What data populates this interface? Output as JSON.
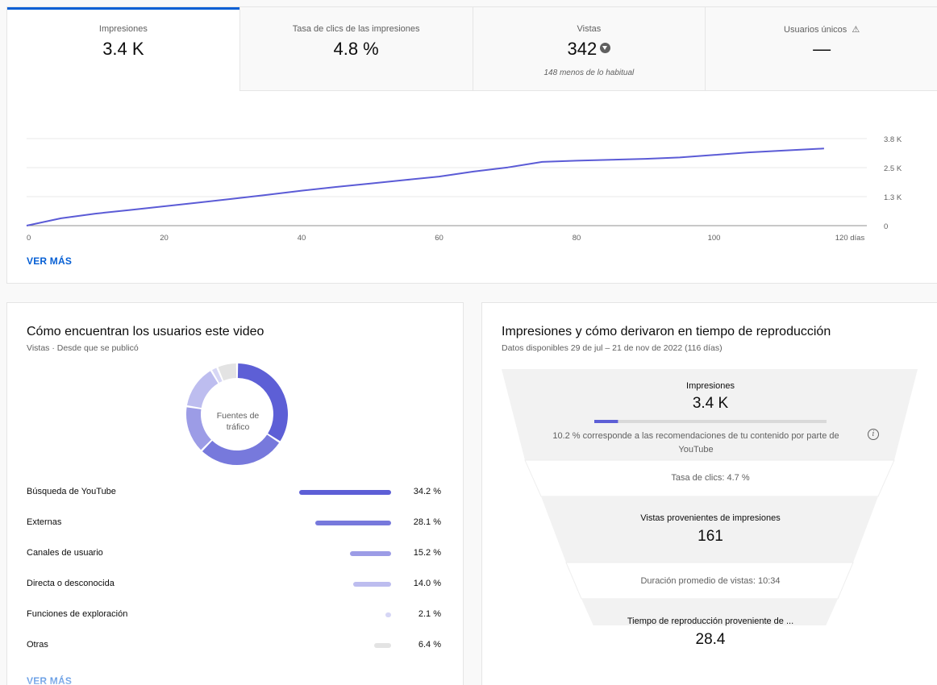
{
  "tabs": [
    {
      "label": "Impresiones",
      "value": "3.4 K",
      "sub": ""
    },
    {
      "label": "Tasa de clics de las impresiones",
      "value": "4.8 %",
      "sub": ""
    },
    {
      "label": "Vistas",
      "value": "342",
      "sub": "148 menos de lo habitual"
    },
    {
      "label": "Usuarios únicos",
      "value": "—",
      "sub": ""
    }
  ],
  "chart_data": {
    "type": "line",
    "x": [
      0,
      5,
      10,
      15,
      20,
      25,
      30,
      35,
      40,
      45,
      50,
      55,
      60,
      65,
      70,
      75,
      80,
      85,
      90,
      95,
      100,
      105,
      110,
      116
    ],
    "y": [
      0,
      320,
      520,
      680,
      840,
      1000,
      1170,
      1340,
      1520,
      1680,
      1830,
      1980,
      2130,
      2350,
      2530,
      2770,
      2820,
      2860,
      2900,
      2960,
      3070,
      3180,
      3260,
      3350
    ],
    "xticks": [
      "0",
      "20",
      "40",
      "60",
      "80",
      "100",
      "120 días"
    ],
    "xtick_values": [
      0,
      20,
      40,
      60,
      80,
      100,
      120
    ],
    "yticks": [
      "0",
      "1.3 K",
      "2.5 K",
      "3.8 K"
    ],
    "ytick_values": [
      0,
      1260,
      2520,
      3780
    ],
    "xlim": [
      0,
      120
    ],
    "ylim": [
      0,
      3780
    ],
    "title": "",
    "xlabel": "",
    "ylabel": "",
    "grid": true,
    "color": "#5b5bd6"
  },
  "top_more_label": "VER MÁS",
  "traffic": {
    "title": "Cómo encuentran los usuarios este video",
    "subtitle": "Vistas · Desde que se publicó",
    "center_label_1": "Fuentes de",
    "center_label_2": "tráfico",
    "sources": [
      {
        "label": "Búsqueda de YouTube",
        "value": 34.2,
        "pct": "34.2 %",
        "color": "#5d5fd6"
      },
      {
        "label": "Externas",
        "value": 28.1,
        "pct": "28.1 %",
        "color": "#7779dc"
      },
      {
        "label": "Canales de usuario",
        "value": 15.2,
        "pct": "15.2 %",
        "color": "#9c9ce6"
      },
      {
        "label": "Directa o desconocida",
        "value": 14.0,
        "pct": "14.0 %",
        "color": "#bdbdef"
      },
      {
        "label": "Funciones de exploración",
        "value": 2.1,
        "pct": "2.1 %",
        "color": "#d6d6f5"
      },
      {
        "label": "Otras",
        "value": 6.4,
        "pct": "6.4 %",
        "color": "#e3e3e3"
      }
    ],
    "more_label": "VER MÁS"
  },
  "funnel": {
    "title": "Impresiones y cómo derivaron en tiempo de reproducción",
    "subtitle": "Datos disponibles 29 de jul – 21 de nov de 2022 (116 días)",
    "impressions_label": "Impresiones",
    "impressions_value": "3.4 K",
    "recommend_fraction": 0.102,
    "recommend_text_1": "10.2 % corresponde a las recomendaciones de tu contenido por parte de",
    "recommend_text_2": "YouTube",
    "ctr_label": "Tasa de clics: 4.7 %",
    "views_label": "Vistas provenientes de impresiones",
    "views_value": "161",
    "avg_label": "Duración promedio de vistas: 10:34",
    "watch_label": "Tiempo de reproducción proveniente de ...",
    "watch_value": "28.4"
  }
}
